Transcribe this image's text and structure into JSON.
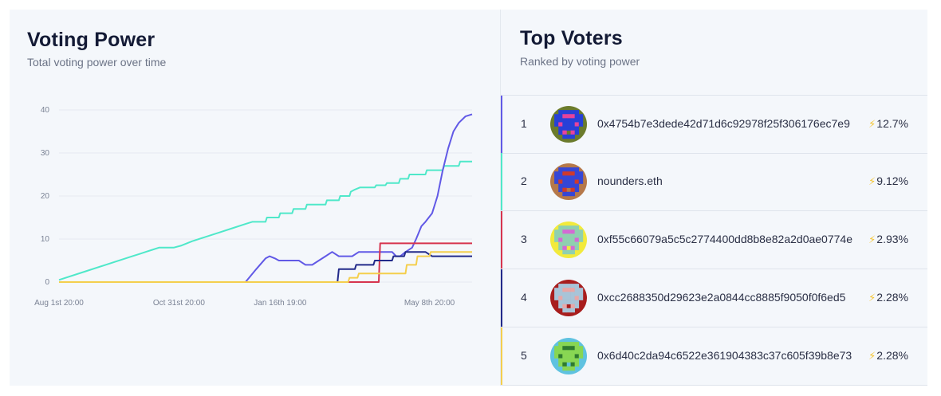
{
  "voting_power": {
    "title": "Voting Power",
    "subtitle": "Total voting power over time"
  },
  "top_voters": {
    "title": "Top Voters",
    "subtitle": "Ranked by voting power",
    "voters": [
      {
        "rank": "1",
        "name": "0x4754b7e3dede42d71d6c92978f25f306176ec7e9",
        "power": "12.7%",
        "color": "#6159e6",
        "avatar": {
          "bg": "#6b7b2c",
          "fg": "#2740d8",
          "accent": "#e7439b"
        }
      },
      {
        "rank": "2",
        "name": "nounders.eth",
        "power": "9.12%",
        "color": "#4fe8c9",
        "avatar": {
          "bg": "#b5784a",
          "fg": "#3546d6",
          "accent": "#cf3a2c"
        }
      },
      {
        "rank": "3",
        "name": "0xf55c66079a5c5c2774400dd8b8e82a2d0ae0774e",
        "power": "2.93%",
        "color": "#d6344e",
        "avatar": {
          "bg": "#f2ea3c",
          "fg": "#8fd0b0",
          "accent": "#d36ad4"
        }
      },
      {
        "rank": "4",
        "name": "0xcc2688350d29623e2a0844cc8885f9050f0f6ed5",
        "power": "2.28%",
        "color": "#222a8a",
        "avatar": {
          "bg": "#a81d1d",
          "fg": "#a8c4d8",
          "accent": "#e9a6a6"
        }
      },
      {
        "rank": "5",
        "name": "0x6d40c2da94c6522e361904383c37c605f39b8e73",
        "power": "2.28%",
        "color": "#f4cf4d",
        "avatar": {
          "bg": "#5fc2e0",
          "fg": "#88d653",
          "accent": "#2f7a2f"
        }
      }
    ]
  },
  "chart_data": {
    "type": "line",
    "x_tick_labels": [
      "Aug 1st 20:00",
      "Oct 31st 20:00",
      "Jan 16th 19:00",
      "May 8th 20:00"
    ],
    "x_tick_pos": [
      0,
      90,
      166,
      278
    ],
    "x_range": [
      0,
      310
    ],
    "ylim": [
      0,
      40
    ],
    "yticks": [
      0,
      10,
      20,
      30,
      40
    ],
    "grid": true,
    "series": [
      {
        "color": "#4fe8c9",
        "points": [
          [
            0,
            0.5
          ],
          [
            20,
            2.5
          ],
          [
            40,
            4.5
          ],
          [
            55,
            6
          ],
          [
            60,
            6.5
          ],
          [
            65,
            7
          ],
          [
            70,
            7.5
          ],
          [
            75,
            8
          ],
          [
            80,
            8
          ],
          [
            86,
            8
          ],
          [
            92,
            8.5
          ],
          [
            100,
            9.5
          ],
          [
            110,
            10.5
          ],
          [
            120,
            11.5
          ],
          [
            130,
            12.5
          ],
          [
            140,
            13.5
          ],
          [
            145,
            14
          ],
          [
            155,
            14
          ],
          [
            156,
            15
          ],
          [
            165,
            15
          ],
          [
            166,
            16
          ],
          [
            175,
            16
          ],
          [
            176,
            17
          ],
          [
            185,
            17
          ],
          [
            186,
            18
          ],
          [
            200,
            18
          ],
          [
            201,
            19
          ],
          [
            210,
            19
          ],
          [
            211,
            20
          ],
          [
            218,
            20
          ],
          [
            219,
            21
          ],
          [
            222,
            21.5
          ],
          [
            226,
            22
          ],
          [
            237,
            22
          ],
          [
            238,
            22.5
          ],
          [
            245,
            22.5
          ],
          [
            246,
            23
          ],
          [
            255,
            23
          ],
          [
            256,
            24
          ],
          [
            262,
            24
          ],
          [
            263,
            25
          ],
          [
            270,
            25
          ],
          [
            271,
            25
          ],
          [
            275,
            25
          ],
          [
            276,
            26
          ],
          [
            288,
            26
          ],
          [
            289,
            27
          ],
          [
            300,
            27
          ],
          [
            301,
            28
          ],
          [
            310,
            28
          ]
        ]
      },
      {
        "color": "#6159e6",
        "points": [
          [
            0,
            0
          ],
          [
            140,
            0
          ],
          [
            148,
            3
          ],
          [
            155,
            5.5
          ],
          [
            158,
            6
          ],
          [
            162,
            5.5
          ],
          [
            165,
            5
          ],
          [
            170,
            5
          ],
          [
            175,
            5
          ],
          [
            180,
            5
          ],
          [
            185,
            4
          ],
          [
            190,
            4
          ],
          [
            195,
            5
          ],
          [
            200,
            6
          ],
          [
            205,
            7
          ],
          [
            210,
            6
          ],
          [
            215,
            6
          ],
          [
            220,
            6
          ],
          [
            225,
            7
          ],
          [
            240,
            7
          ],
          [
            245,
            7
          ],
          [
            250,
            7
          ],
          [
            253,
            6
          ],
          [
            256,
            6
          ],
          [
            260,
            7
          ],
          [
            265,
            8
          ],
          [
            268,
            10
          ],
          [
            272,
            13
          ],
          [
            275,
            14
          ],
          [
            280,
            16
          ],
          [
            284,
            20
          ],
          [
            288,
            26
          ],
          [
            292,
            31
          ],
          [
            296,
            35
          ],
          [
            300,
            37
          ],
          [
            305,
            38.5
          ],
          [
            310,
            39
          ]
        ]
      },
      {
        "color": "#d6344e",
        "points": [
          [
            0,
            0
          ],
          [
            240,
            0
          ],
          [
            241,
            9
          ],
          [
            310,
            9
          ]
        ]
      },
      {
        "color": "#222a8a",
        "points": [
          [
            0,
            0
          ],
          [
            209,
            0
          ],
          [
            210,
            3
          ],
          [
            222,
            3
          ],
          [
            223,
            4
          ],
          [
            236,
            4
          ],
          [
            237,
            5
          ],
          [
            250,
            5
          ],
          [
            251,
            6
          ],
          [
            259,
            6
          ],
          [
            260,
            7
          ],
          [
            275,
            7
          ],
          [
            280,
            6
          ],
          [
            310,
            6
          ]
        ]
      },
      {
        "color": "#f4cf4d",
        "points": [
          [
            0,
            0
          ],
          [
            217,
            0
          ],
          [
            218,
            1
          ],
          [
            224,
            1
          ],
          [
            225,
            2
          ],
          [
            240,
            2
          ],
          [
            241,
            2
          ],
          [
            260,
            2
          ],
          [
            261,
            4
          ],
          [
            268,
            4
          ],
          [
            269,
            6
          ],
          [
            278,
            6
          ],
          [
            279,
            7
          ],
          [
            310,
            7
          ]
        ]
      }
    ]
  }
}
